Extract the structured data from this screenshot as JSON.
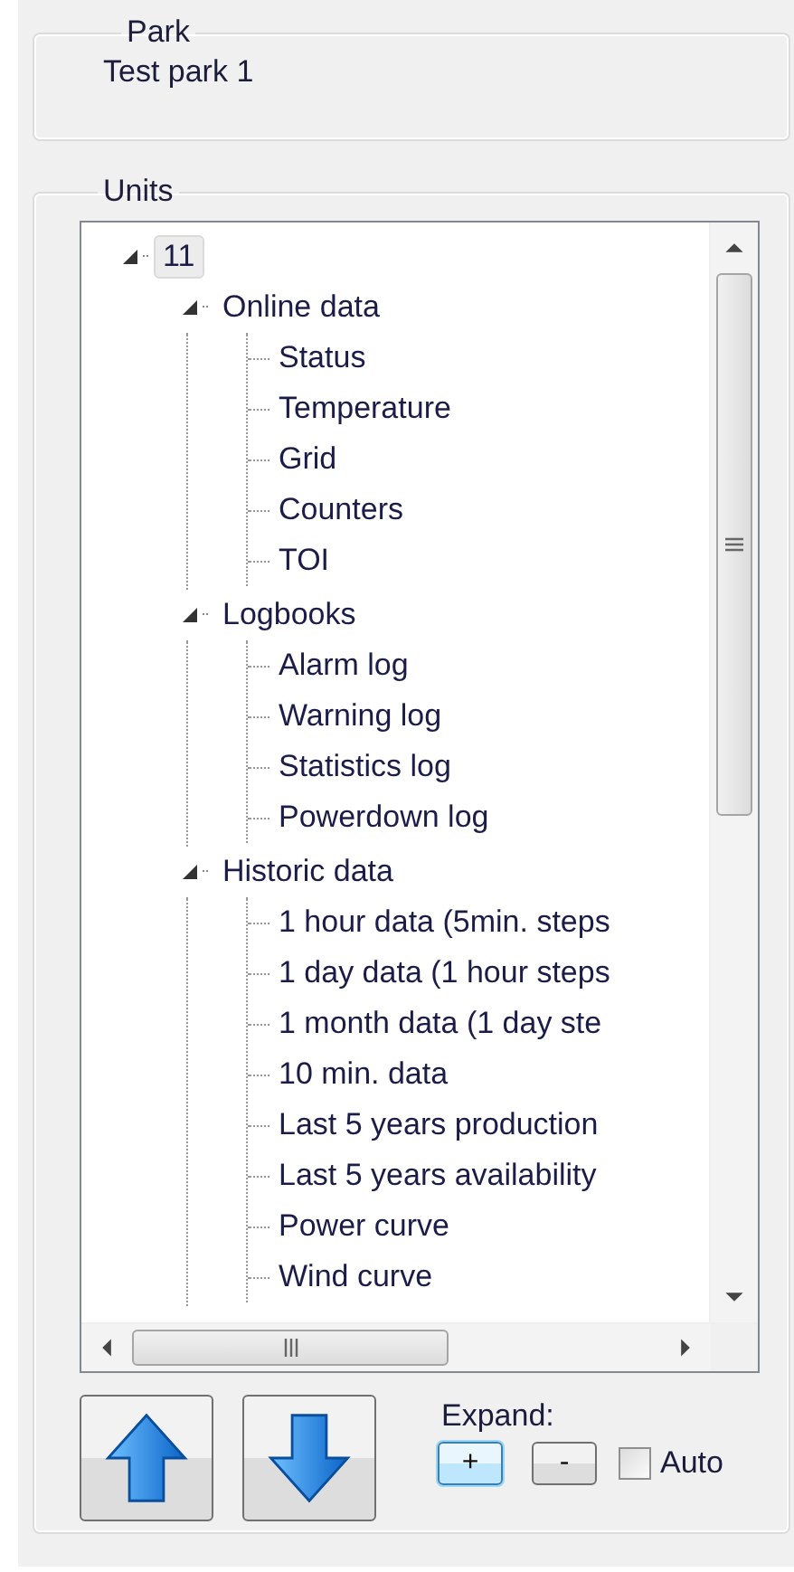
{
  "park": {
    "title": "Park",
    "value": "Test park 1"
  },
  "units": {
    "title": "Units",
    "tree": [
      {
        "label": "11",
        "expanded": true,
        "selected": true,
        "children": [
          {
            "label": "Online data",
            "expanded": true,
            "selected": false,
            "children": [
              {
                "label": "Status",
                "selected": false
              },
              {
                "label": "Temperature",
                "selected": false
              },
              {
                "label": "Grid",
                "selected": false
              },
              {
                "label": "Counters",
                "selected": false
              },
              {
                "label": "TOI",
                "selected": false
              }
            ]
          },
          {
            "label": "Logbooks",
            "expanded": true,
            "selected": false,
            "children": [
              {
                "label": "Alarm log",
                "selected": false
              },
              {
                "label": "Warning log",
                "selected": false
              },
              {
                "label": "Statistics log",
                "selected": false
              },
              {
                "label": "Powerdown log",
                "selected": false
              }
            ]
          },
          {
            "label": "Historic data",
            "expanded": true,
            "selected": false,
            "children": [
              {
                "label": "1 hour data (5min. steps",
                "selected": false
              },
              {
                "label": "1 day data (1 hour steps",
                "selected": false
              },
              {
                "label": "1 month data (1 day ste",
                "selected": false
              },
              {
                "label": "10 min. data",
                "selected": false
              },
              {
                "label": "Last 5 years production",
                "selected": false
              },
              {
                "label": "Last 5 years availability",
                "selected": false
              },
              {
                "label": "Power curve",
                "selected": false
              },
              {
                "label": "Wind curve",
                "selected": false
              }
            ]
          }
        ]
      }
    ],
    "expand": {
      "label": "Expand:",
      "plus": {
        "label": "+",
        "focused": true
      },
      "minus": {
        "label": "-",
        "focused": false
      },
      "auto": {
        "label": "Auto",
        "checked": false
      }
    }
  }
}
